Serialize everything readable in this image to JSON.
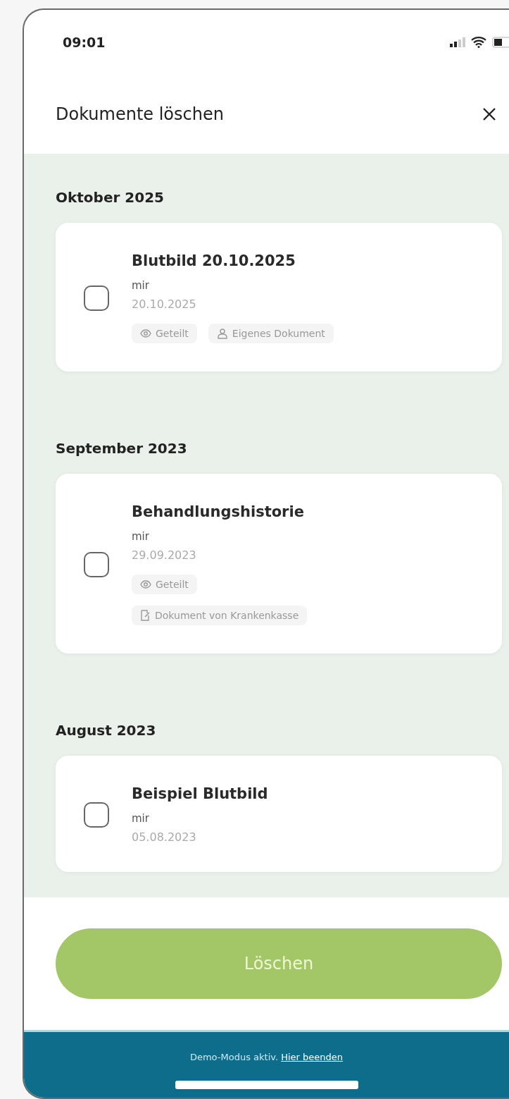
{
  "status_bar": {
    "time": "09:01"
  },
  "header": {
    "title": "Dokumente löschen"
  },
  "sections": [
    {
      "heading": "Oktober 2025",
      "documents": [
        {
          "title": "Blutbild 20.10.2025",
          "owner": "mir",
          "date": "20.10.2025",
          "checked": false,
          "tags": [
            {
              "kind": "shared",
              "label": "Geteilt"
            },
            {
              "kind": "own",
              "label": "Eigenes Dokument"
            }
          ]
        }
      ]
    },
    {
      "heading": "September 2023",
      "documents": [
        {
          "title": "Behandlungshistorie",
          "owner": "mir",
          "date": "29.09.2023",
          "checked": false,
          "tags": [
            {
              "kind": "shared",
              "label": "Geteilt"
            },
            {
              "kind": "insurer",
              "label": "Dokument von Krankenkasse"
            }
          ]
        }
      ]
    },
    {
      "heading": "August 2023",
      "documents": [
        {
          "title": "Beispiel Blutbild",
          "owner": "mir",
          "date": "05.08.2023",
          "checked": false
        }
      ]
    }
  ],
  "delete_button": {
    "label": "Löschen",
    "disabled": true
  },
  "demo_banner": {
    "text": "Demo-Modus aktiv. ",
    "link": "Hier beenden"
  }
}
